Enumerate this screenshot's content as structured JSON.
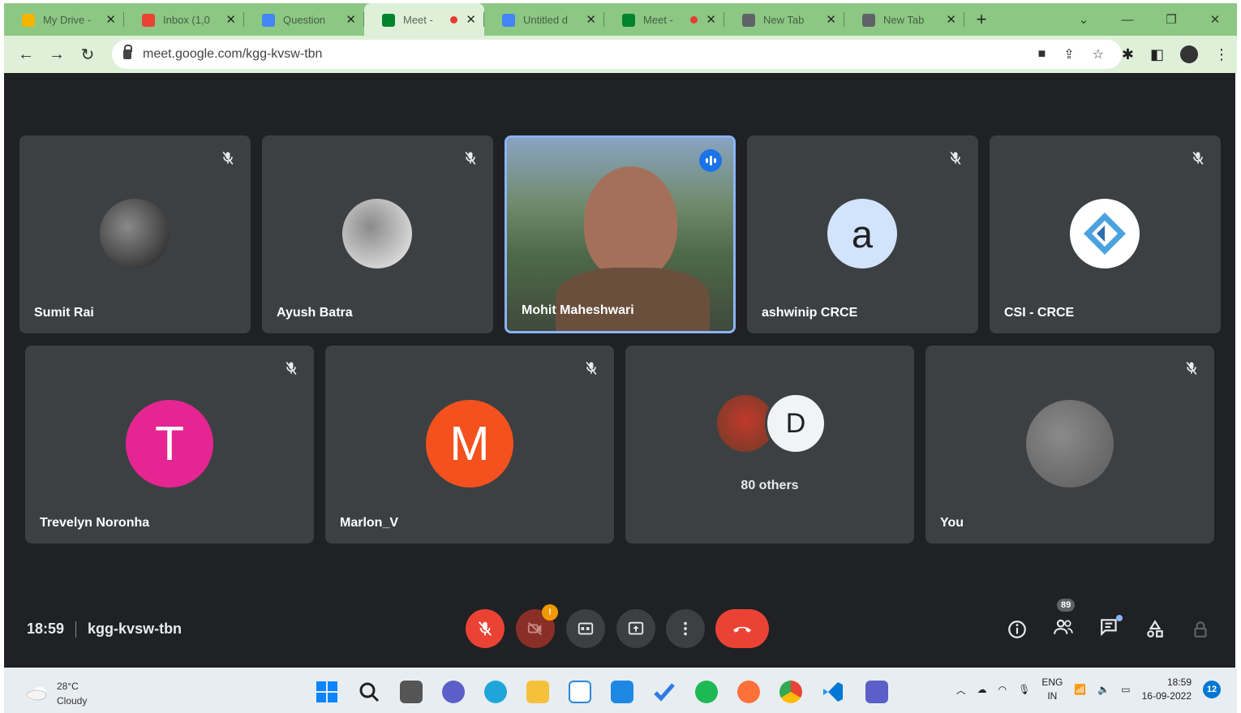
{
  "browser": {
    "tabs": [
      {
        "title": "My Drive -",
        "favicon_color": "#f4b400",
        "recording": false,
        "active": false
      },
      {
        "title": "Inbox (1,0",
        "favicon_color": "#ea4335",
        "recording": false,
        "active": false
      },
      {
        "title": "Question",
        "favicon_color": "#4285f4",
        "recording": false,
        "active": false
      },
      {
        "title": "Meet -",
        "favicon_color": "#00832d",
        "recording": true,
        "active": true
      },
      {
        "title": "Untitled d",
        "favicon_color": "#4285f4",
        "recording": false,
        "active": false
      },
      {
        "title": "Meet -",
        "favicon_color": "#00832d",
        "recording": true,
        "active": false
      },
      {
        "title": "New Tab",
        "favicon_color": "#5f6368",
        "recording": false,
        "active": false
      },
      {
        "title": "New Tab",
        "favicon_color": "#5f6368",
        "recording": false,
        "active": false
      }
    ],
    "close_glyph": "✕",
    "new_tab_glyph": "+",
    "url": "meet.google.com/kgg-kvsw-tbn"
  },
  "meeting": {
    "participants_row1": [
      {
        "name": "Sumit Rai",
        "avatar_type": "image",
        "avatar_color": "#1c1c1c",
        "muted": true
      },
      {
        "name": "Ayush Batra",
        "avatar_type": "image",
        "avatar_color": "#f2f2f2",
        "muted": true
      },
      {
        "name": "Mohit Maheshwari",
        "avatar_type": "video",
        "muted": false,
        "speaking": true
      },
      {
        "name": "ashwinip CRCE",
        "avatar_type": "letter",
        "letter": "a",
        "avatar_color": "#d2e3fc",
        "letter_color": "#202124",
        "muted": true
      },
      {
        "name": "CSI - CRCE",
        "avatar_type": "logo",
        "avatar_color": "#ffffff",
        "muted": true
      }
    ],
    "participants_row2": [
      {
        "name": "Trevelyn Noronha",
        "avatar_type": "letter",
        "letter": "T",
        "avatar_color": "#e52592",
        "letter_color": "#ffffff",
        "muted": true
      },
      {
        "name": "Marlon_V",
        "avatar_type": "letter",
        "letter": "M",
        "avatar_color": "#f4511e",
        "letter_color": "#ffffff",
        "muted": true
      },
      {
        "name": "80 others",
        "avatar_type": "group",
        "letter": "D",
        "muted": false
      },
      {
        "name": "You",
        "avatar_type": "image",
        "avatar_color": "#5a5a5a",
        "muted": true
      }
    ],
    "time": "18:59",
    "meeting_code": "kgg-kvsw-tbn",
    "people_count": "89",
    "camera_warning_badge": "!"
  },
  "taskbar": {
    "weather_temp": "28°C",
    "weather_desc": "Cloudy",
    "lang_top": "ENG",
    "lang_bottom": "IN",
    "clock_time": "18:59",
    "clock_date": "16-09-2022",
    "notification_count": "12"
  },
  "colors": {
    "tabstrip": "#8cc784",
    "toolbar": "#dff0d8",
    "stage": "#202124",
    "tile": "#3c4043",
    "mic_off": "#ea4335",
    "hangup": "#ea4335",
    "control": "#3c4043"
  }
}
